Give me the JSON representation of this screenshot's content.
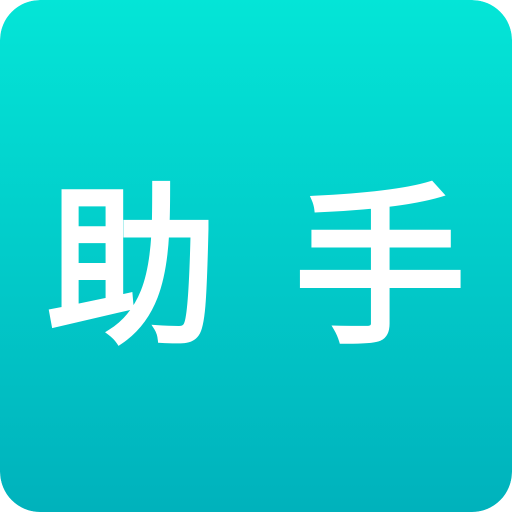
{
  "icon": {
    "label": "助手",
    "text_color": "#ffffff",
    "gradient_top_color": "#04e5d7",
    "gradient_bottom_color": "#00b2bc"
  }
}
